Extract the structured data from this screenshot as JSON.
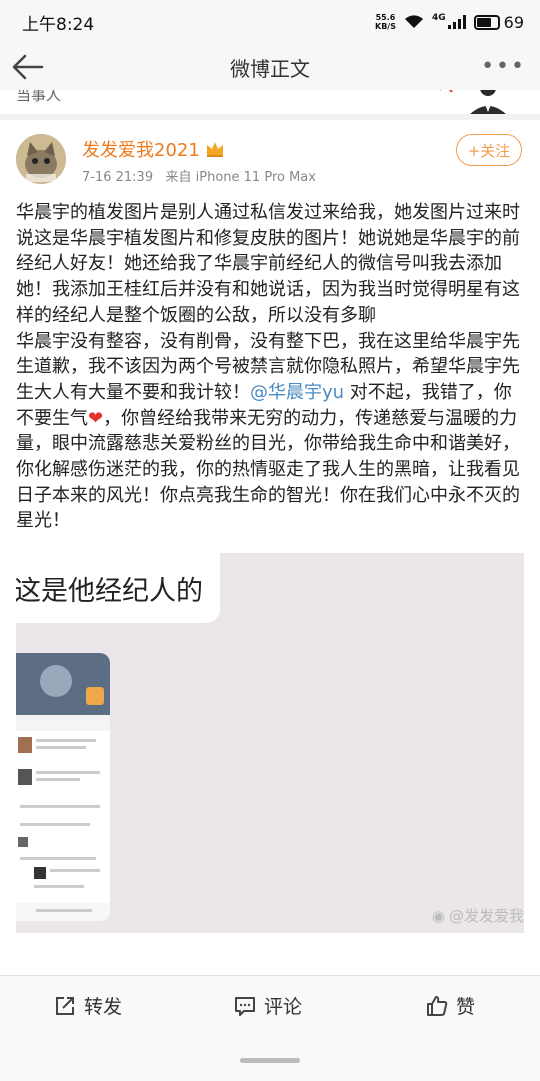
{
  "status_bar": {
    "time": "上午8:24",
    "net_speed_value": "55.6",
    "net_speed_unit": "KB/S",
    "network": "4G",
    "battery": "69"
  },
  "nav": {
    "title": "微博正文"
  },
  "previous": {
    "text": "当事人"
  },
  "post": {
    "username": "发发爱我2021",
    "timestamp": "7-16 21:39",
    "source": "来自 iPhone 11 Pro Max",
    "follow_label": "+关注",
    "para1": "华晨宇的植发图片是别人通过私信发过来给我，她发图片过来时说这是华晨宇植发图片和修复皮肤的图片！她说她是华晨宇的前经纪人好友！她还给我了华晨宇前经纪人的微信号叫我去添加她！我添加王桂红后并没有和她说话，因为我当时觉得明星有这样的经纪人是整个饭圈的公敌，所以没有多聊",
    "para2_a": "华晨宇没有整容，没有削骨，没有整下巴，我在这里给华晨宇先生道歉，我不该因为两个号被禁言就你隐私照片，希望华晨宇先生大人有大量不要和我计较！",
    "mention": "@华晨宇yu",
    "para2_b": " 对不起，我错了，你不要生气",
    "heart": "❤",
    "para2_c": "，你曾经给我带来无穷的动力，传递慈爱与温暖的力量，眼中流露慈悲关爱粉丝的目光，你带给我生命中和谐美好，你化解感伤迷茫的我，你的热情驱走了我人生的黑暗，让我看见日子本来的风光！你点亮我生命的智光！你在我们心中永不灭的星光！",
    "image": {
      "chat_bubble_text": "这是他经纪人的",
      "watermark": "@发发爱我"
    }
  },
  "actions": {
    "repost": "转发",
    "comment": "评论",
    "like": "赞"
  }
}
